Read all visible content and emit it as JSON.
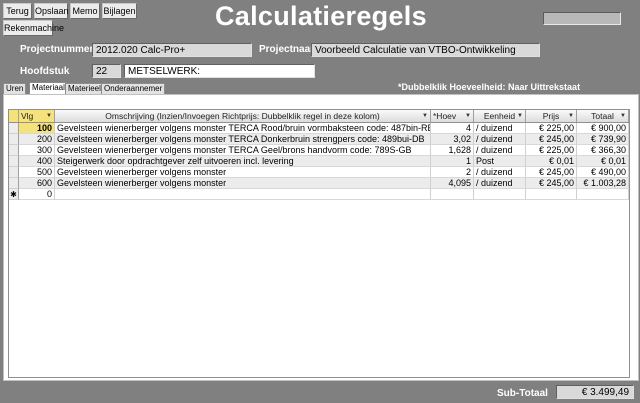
{
  "toolbar": {
    "terug": "Terug",
    "opslaan": "Opslaan",
    "memo": "Memo",
    "bijlagen": "Bijlagen",
    "rekenmachine": "Rekenmachine"
  },
  "title": "Calculatieregels",
  "form": {
    "projectnummer_label": "Projectnummer",
    "projectnummer_value": "2012.020 Calc-Pro+",
    "projectnaam_label": "Projectnaam",
    "projectnaam_value": "Voorbeeld Calculatie van VTBO-Ontwikkeling",
    "hoofdstuk_label": "Hoofdstuk",
    "hoofdstuk_nr": "22",
    "hoofdstuk_naam": "METSELWERK:"
  },
  "note": "*Dubbelklik Hoeveelheid: Naar Uittrekstaat",
  "tabs": [
    "Uren",
    "Materiaal",
    "Materieel",
    "Onderaannemer"
  ],
  "active_tab": "Materiaal",
  "grid": {
    "headers": [
      "Vlg",
      "Omschrijving (Inzien/Invoegen Richtprijs: Dubbelklik regel in deze kolom)",
      "*Hoev",
      "Eenheid",
      "Prijs",
      "Totaal"
    ],
    "rows": [
      {
        "vlg": "100",
        "omschrijving": "Gevelsteen wienerberger volgens monster TERCA Rood/bruin vormbaksteen code: 487bin-RB",
        "hoev": "4",
        "eenheid": "/ duizend",
        "prijs": "€ 225,00",
        "totaal": "€ 900,00"
      },
      {
        "vlg": "200",
        "omschrijving": "Gevelsteen wienerberger volgens monster TERCA Donkerbruin strengpers code: 489bui-DB",
        "hoev": "3,02",
        "eenheid": "/ duizend",
        "prijs": "€ 245,00",
        "totaal": "€ 739,90"
      },
      {
        "vlg": "300",
        "omschrijving": "Gevelsteen wienerberger volgens monster TERCA Geel/brons handvorm code: 789S-GB",
        "hoev": "1,628",
        "eenheid": "/ duizend",
        "prijs": "€ 225,00",
        "totaal": "€ 366,30"
      },
      {
        "vlg": "400",
        "omschrijving": "Steigerwerk door opdrachtgever zelf uitvoeren incl. levering",
        "hoev": "1",
        "eenheid": "Post",
        "prijs": "€ 0,01",
        "totaal": "€ 0,01"
      },
      {
        "vlg": "500",
        "omschrijving": "Gevelsteen wienerberger volgens monster",
        "hoev": "2",
        "eenheid": "/ duizend",
        "prijs": "€ 245,00",
        "totaal": "€ 490,00"
      },
      {
        "vlg": "600",
        "omschrijving": "Gevelsteen wienerberger volgens monster",
        "hoev": "4,095",
        "eenheid": "/ duizend",
        "prijs": "€ 245,00",
        "totaal": "€ 1.003,28"
      }
    ],
    "new_row_vlg": "0"
  },
  "subtotal": {
    "label": "Sub-Totaal",
    "value": "€ 3.499,49"
  }
}
